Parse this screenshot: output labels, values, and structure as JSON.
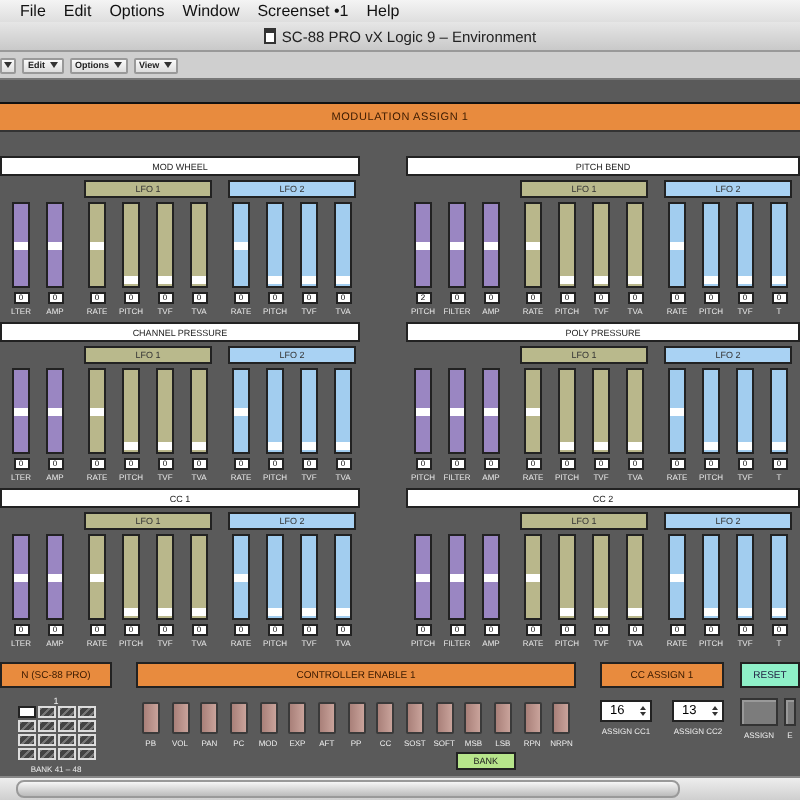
{
  "menu_bar": [
    "File",
    "Edit",
    "Options",
    "Window",
    "Screenset •1",
    "Help"
  ],
  "window": {
    "title": "SC-88 PRO vX Logic 9 – Environment"
  },
  "toolbar": {
    "menus": [
      "Edit",
      "Options",
      "View"
    ]
  },
  "modulation": {
    "title": "MODULATION ASSIGN 1"
  },
  "groups": [
    {
      "title": "MOD WHEEL",
      "sections": [
        {
          "kind": "mod",
          "sliders": [
            {
              "label": "LTER",
              "value": "0",
              "level": 0.5
            },
            {
              "label": "AMP",
              "value": "0",
              "level": 0.5
            }
          ]
        },
        {
          "kind": "lfo1",
          "label": "LFO 1",
          "sliders": [
            {
              "label": "RATE",
              "value": "0",
              "level": 0.5
            },
            {
              "label": "PITCH",
              "value": "0",
              "level": 0.04
            },
            {
              "label": "TVF",
              "value": "0",
              "level": 0.04
            },
            {
              "label": "TVA",
              "value": "0",
              "level": 0.04
            }
          ]
        },
        {
          "kind": "lfo2",
          "label": "LFO 2",
          "sliders": [
            {
              "label": "RATE",
              "value": "0",
              "level": 0.5
            },
            {
              "label": "PITCH",
              "value": "0",
              "level": 0.04
            },
            {
              "label": "TVF",
              "value": "0",
              "level": 0.04
            },
            {
              "label": "TVA",
              "value": "0",
              "level": 0.04
            }
          ]
        }
      ]
    },
    {
      "title": "PITCH BEND",
      "sections": [
        {
          "kind": "mod",
          "sliders": [
            {
              "label": "PITCH",
              "value": "2",
              "level": 0.5
            },
            {
              "label": "FILTER",
              "value": "0",
              "level": 0.5
            },
            {
              "label": "AMP",
              "value": "0",
              "level": 0.5
            }
          ]
        },
        {
          "kind": "lfo1",
          "label": "LFO 1",
          "sliders": [
            {
              "label": "RATE",
              "value": "0",
              "level": 0.5
            },
            {
              "label": "PITCH",
              "value": "0",
              "level": 0.04
            },
            {
              "label": "TVF",
              "value": "0",
              "level": 0.04
            },
            {
              "label": "TVA",
              "value": "0",
              "level": 0.04
            }
          ]
        },
        {
          "kind": "lfo2",
          "label": "LFO 2",
          "sliders": [
            {
              "label": "RATE",
              "value": "0",
              "level": 0.5
            },
            {
              "label": "PITCH",
              "value": "0",
              "level": 0.04
            },
            {
              "label": "TVF",
              "value": "0",
              "level": 0.04
            },
            {
              "label": "T",
              "value": "0",
              "level": 0.04
            }
          ]
        }
      ]
    },
    {
      "title": "CHANNEL PRESSURE",
      "sections": [
        {
          "kind": "mod",
          "sliders": [
            {
              "label": "LTER",
              "value": "0",
              "level": 0.5
            },
            {
              "label": "AMP",
              "value": "0",
              "level": 0.5
            }
          ]
        },
        {
          "kind": "lfo1",
          "label": "LFO 1",
          "sliders": [
            {
              "label": "RATE",
              "value": "0",
              "level": 0.5
            },
            {
              "label": "PITCH",
              "value": "0",
              "level": 0.04
            },
            {
              "label": "TVF",
              "value": "0",
              "level": 0.04
            },
            {
              "label": "TVA",
              "value": "0",
              "level": 0.04
            }
          ]
        },
        {
          "kind": "lfo2",
          "label": "LFO 2",
          "sliders": [
            {
              "label": "RATE",
              "value": "0",
              "level": 0.5
            },
            {
              "label": "PITCH",
              "value": "0",
              "level": 0.04
            },
            {
              "label": "TVF",
              "value": "0",
              "level": 0.04
            },
            {
              "label": "TVA",
              "value": "0",
              "level": 0.04
            }
          ]
        }
      ]
    },
    {
      "title": "POLY PRESSURE",
      "sections": [
        {
          "kind": "mod",
          "sliders": [
            {
              "label": "PITCH",
              "value": "0",
              "level": 0.5
            },
            {
              "label": "FILTER",
              "value": "0",
              "level": 0.5
            },
            {
              "label": "AMP",
              "value": "0",
              "level": 0.5
            }
          ]
        },
        {
          "kind": "lfo1",
          "label": "LFO 1",
          "sliders": [
            {
              "label": "RATE",
              "value": "0",
              "level": 0.5
            },
            {
              "label": "PITCH",
              "value": "0",
              "level": 0.04
            },
            {
              "label": "TVF",
              "value": "0",
              "level": 0.04
            },
            {
              "label": "TVA",
              "value": "0",
              "level": 0.04
            }
          ]
        },
        {
          "kind": "lfo2",
          "label": "LFO 2",
          "sliders": [
            {
              "label": "RATE",
              "value": "0",
              "level": 0.5
            },
            {
              "label": "PITCH",
              "value": "0",
              "level": 0.04
            },
            {
              "label": "TVF",
              "value": "0",
              "level": 0.04
            },
            {
              "label": "T",
              "value": "0",
              "level": 0.04
            }
          ]
        }
      ]
    },
    {
      "title": "CC 1",
      "sections": [
        {
          "kind": "mod",
          "sliders": [
            {
              "label": "LTER",
              "value": "0",
              "level": 0.5
            },
            {
              "label": "AMP",
              "value": "0",
              "level": 0.5
            }
          ]
        },
        {
          "kind": "lfo1",
          "label": "LFO 1",
          "sliders": [
            {
              "label": "RATE",
              "value": "0",
              "level": 0.5
            },
            {
              "label": "PITCH",
              "value": "0",
              "level": 0.04
            },
            {
              "label": "TVF",
              "value": "0",
              "level": 0.04
            },
            {
              "label": "TVA",
              "value": "0",
              "level": 0.04
            }
          ]
        },
        {
          "kind": "lfo2",
          "label": "LFO 2",
          "sliders": [
            {
              "label": "RATE",
              "value": "0",
              "level": 0.5
            },
            {
              "label": "PITCH",
              "value": "0",
              "level": 0.04
            },
            {
              "label": "TVF",
              "value": "0",
              "level": 0.04
            },
            {
              "label": "TVA",
              "value": "0",
              "level": 0.04
            }
          ]
        }
      ]
    },
    {
      "title": "CC 2",
      "sections": [
        {
          "kind": "mod",
          "sliders": [
            {
              "label": "PITCH",
              "value": "0",
              "level": 0.5
            },
            {
              "label": "FILTER",
              "value": "0",
              "level": 0.5
            },
            {
              "label": "AMP",
              "value": "0",
              "level": 0.5
            }
          ]
        },
        {
          "kind": "lfo1",
          "label": "LFO 1",
          "sliders": [
            {
              "label": "RATE",
              "value": "0",
              "level": 0.5
            },
            {
              "label": "PITCH",
              "value": "0",
              "level": 0.04
            },
            {
              "label": "TVF",
              "value": "0",
              "level": 0.04
            },
            {
              "label": "TVA",
              "value": "0",
              "level": 0.04
            }
          ]
        },
        {
          "kind": "lfo2",
          "label": "LFO 2",
          "sliders": [
            {
              "label": "RATE",
              "value": "0",
              "level": 0.5
            },
            {
              "label": "PITCH",
              "value": "0",
              "level": 0.04
            },
            {
              "label": "TVF",
              "value": "0",
              "level": 0.04
            },
            {
              "label": "T",
              "value": "0",
              "level": 0.04
            }
          ]
        }
      ]
    }
  ],
  "bank": {
    "title": "N (SC-88 PRO)",
    "grid_label": "1",
    "caption": "BANK 41 – 48",
    "cells": [
      {
        "selected": true
      },
      {
        "selected": false
      },
      {
        "selected": false
      },
      {
        "selected": false
      },
      {
        "selected": false
      },
      {
        "selected": false
      },
      {
        "selected": false
      },
      {
        "selected": false
      },
      {
        "selected": false
      },
      {
        "selected": false
      },
      {
        "selected": false
      },
      {
        "selected": false
      },
      {
        "selected": false
      },
      {
        "selected": false
      },
      {
        "selected": false
      },
      {
        "selected": false
      }
    ]
  },
  "controller": {
    "title": "CONTROLLER ENABLE 1",
    "toggles": [
      {
        "label": "PB",
        "on": false
      },
      {
        "label": "VOL",
        "on": false
      },
      {
        "label": "PAN",
        "on": false
      },
      {
        "label": "PC",
        "on": false
      },
      {
        "label": "MOD",
        "on": false
      },
      {
        "label": "EXP",
        "on": false
      },
      {
        "label": "AFT",
        "on": false
      },
      {
        "label": "PP",
        "on": false
      },
      {
        "label": "CC",
        "on": false
      },
      {
        "label": "SOST",
        "on": false
      },
      {
        "label": "SOFT",
        "on": false
      },
      {
        "label": "MSB",
        "on": false
      },
      {
        "label": "LSB",
        "on": false
      },
      {
        "label": "RPN",
        "on": false
      },
      {
        "label": "NRPN",
        "on": false
      }
    ],
    "tag": "BANK"
  },
  "cc_assign": {
    "title": "CC ASSIGN 1",
    "fields": [
      {
        "value": "16",
        "label": "ASSIGN CC1"
      },
      {
        "value": "13",
        "label": "ASSIGN CC2"
      }
    ]
  },
  "reset": {
    "title": "RESET",
    "buttons": [
      "ASSIGN",
      "E"
    ]
  }
}
